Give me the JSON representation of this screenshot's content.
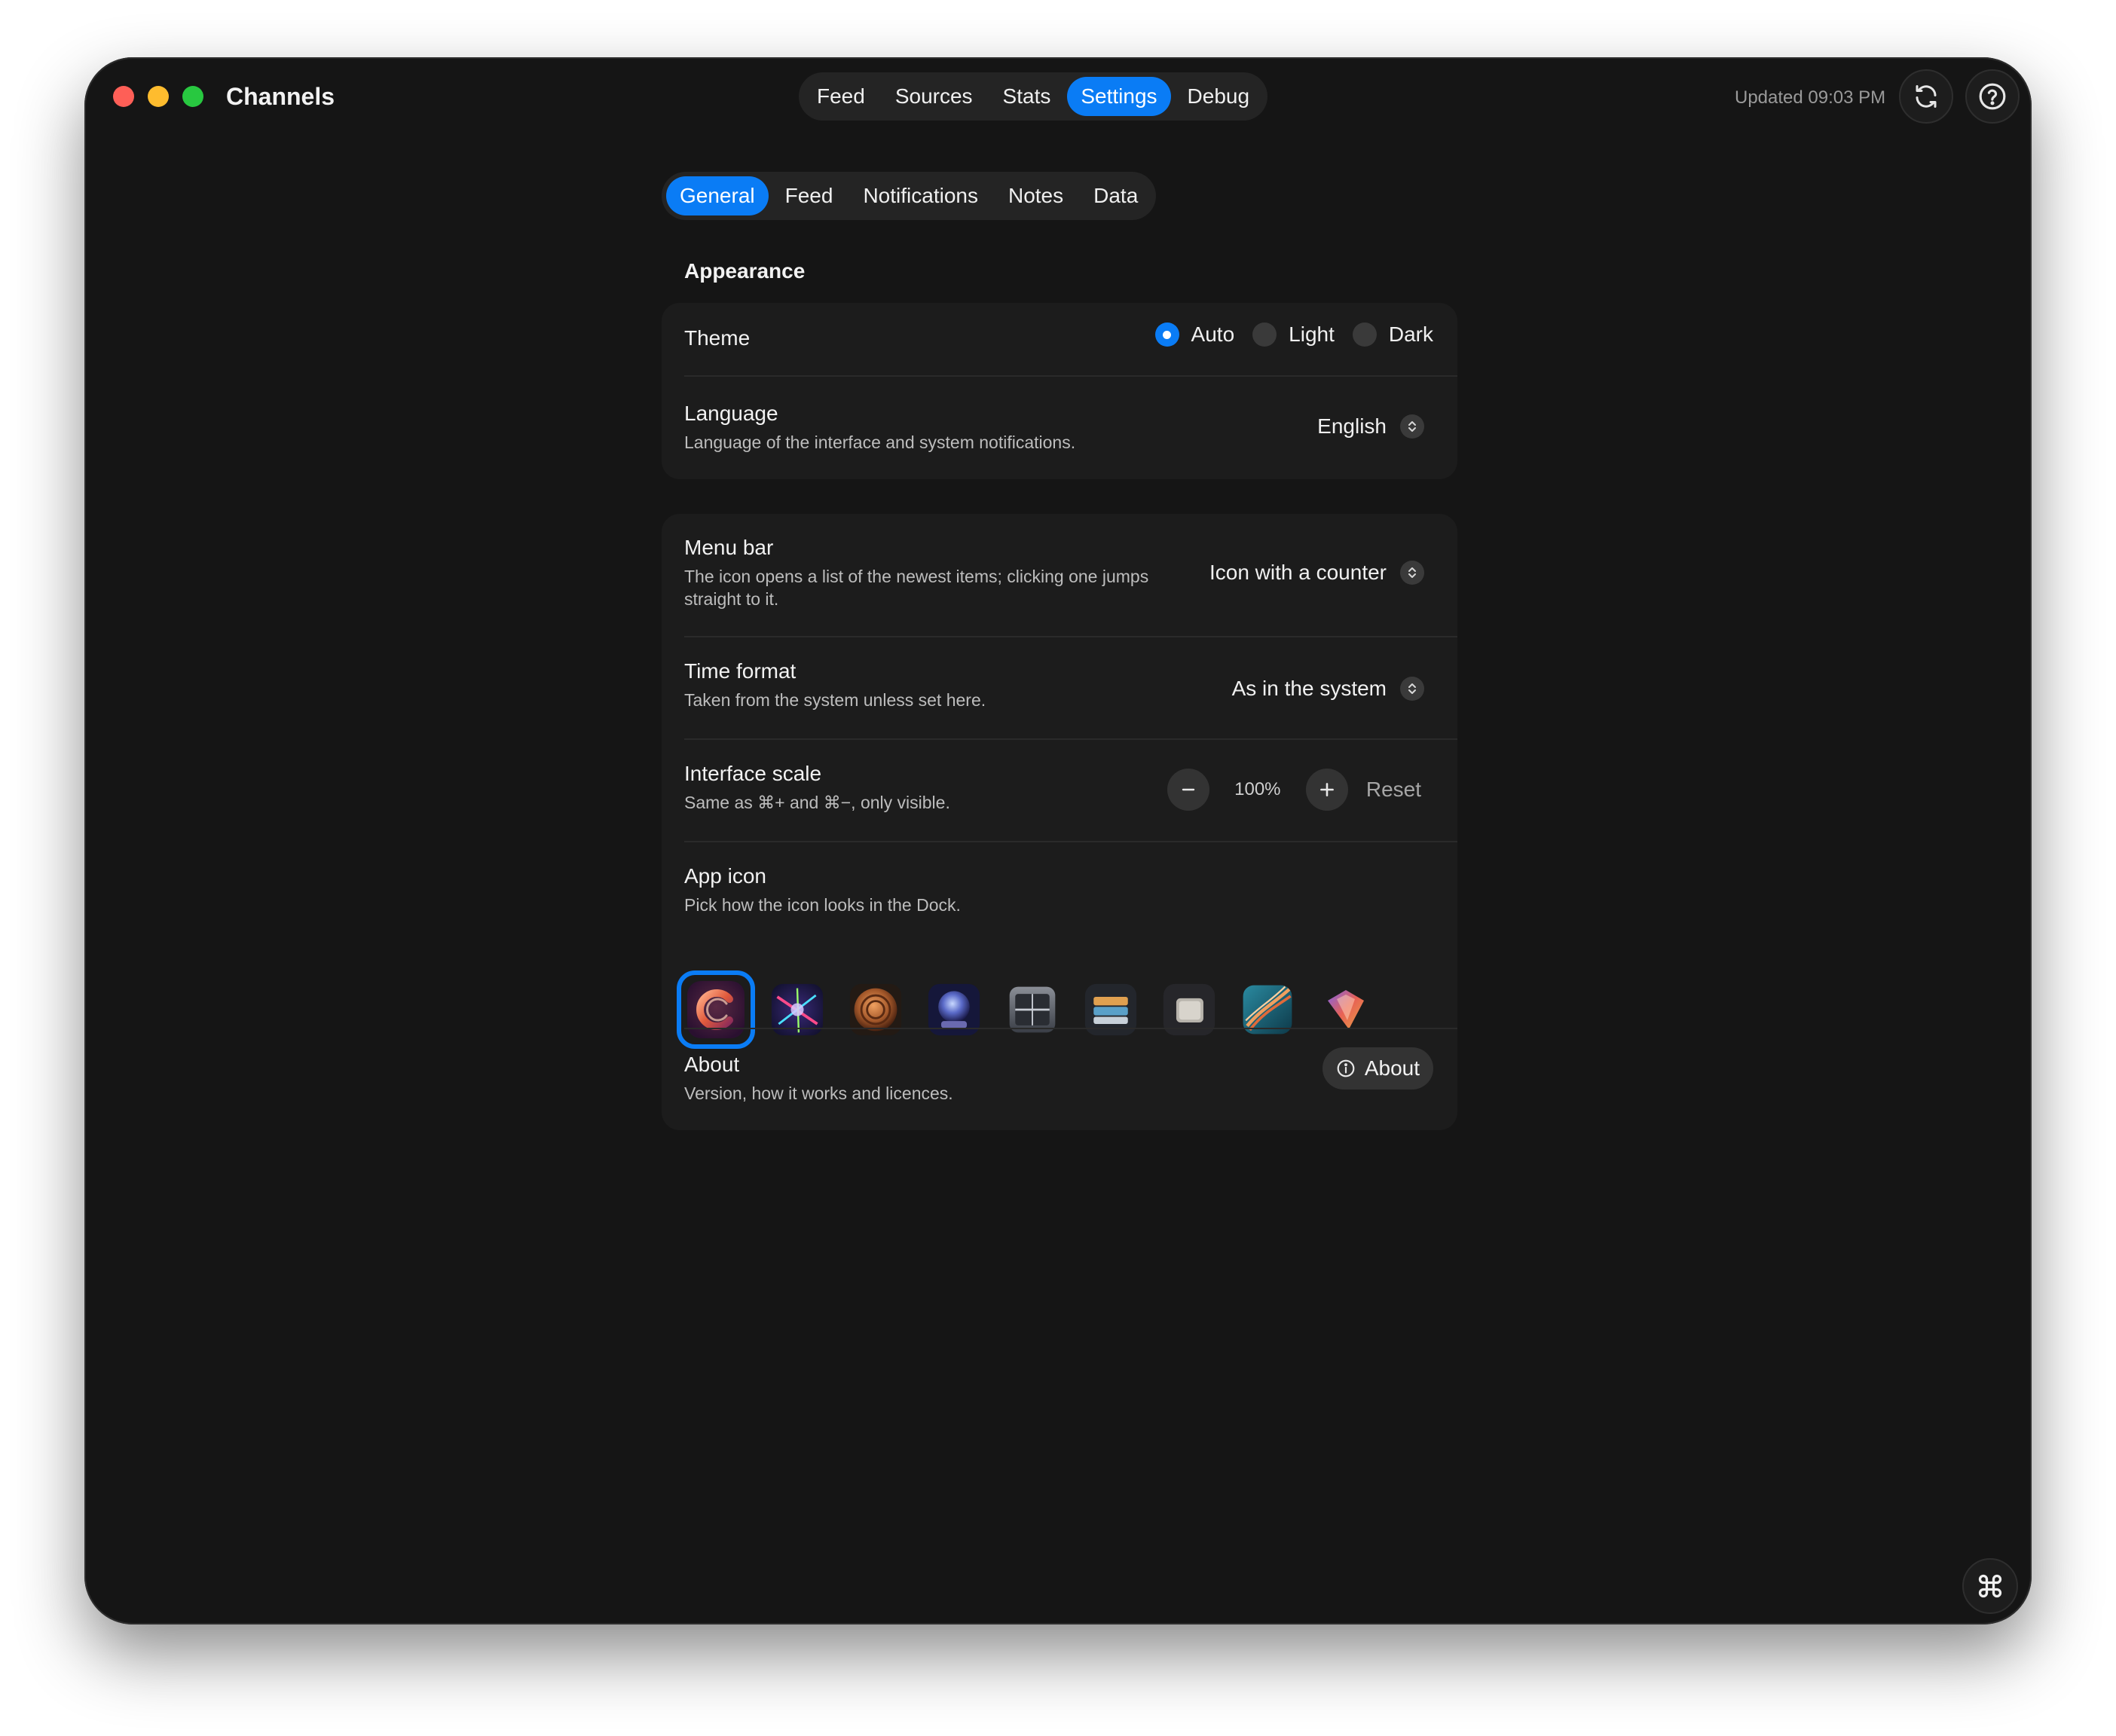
{
  "window": {
    "title": "Channels",
    "updated": "Updated 09:03 PM"
  },
  "top_tabs": [
    {
      "label": "Feed",
      "active": false
    },
    {
      "label": "Sources",
      "active": false
    },
    {
      "label": "Stats",
      "active": false
    },
    {
      "label": "Settings",
      "active": true
    },
    {
      "label": "Debug",
      "active": false
    }
  ],
  "sub_tabs": [
    {
      "label": "General",
      "active": true
    },
    {
      "label": "Feed",
      "active": false
    },
    {
      "label": "Notifications",
      "active": false
    },
    {
      "label": "Notes",
      "active": false
    },
    {
      "label": "Data",
      "active": false
    }
  ],
  "appearance": {
    "heading": "Appearance",
    "theme": {
      "title": "Theme",
      "options": [
        {
          "label": "Auto",
          "selected": true
        },
        {
          "label": "Light",
          "selected": false
        },
        {
          "label": "Dark",
          "selected": false
        }
      ]
    },
    "language": {
      "title": "Language",
      "description": "Language of the interface and system notifications.",
      "value": "English"
    }
  },
  "general": {
    "menu_bar": {
      "title": "Menu bar",
      "description": "The icon opens a list of the newest items; clicking one jumps straight to it.",
      "value": "Icon with a counter"
    },
    "time_format": {
      "title": "Time format",
      "description": "Taken from the system unless set here.",
      "value": "As in the system"
    },
    "interface_scale": {
      "title": "Interface scale",
      "description": "Same as ⌘+ and ⌘−, only visible.",
      "value": "100%",
      "reset_label": "Reset"
    },
    "app_icon": {
      "title": "App icon",
      "description": "Pick how the icon looks in the Dock.",
      "selected_index": 0,
      "icons": [
        "classic-icon",
        "prism-icon",
        "bronze-icon",
        "globe-icon",
        "steel-icon",
        "archive-icon",
        "paper-icon",
        "ribbon-icon",
        "gem-icon"
      ]
    },
    "about": {
      "title": "About",
      "description": "Version, how it works and licences.",
      "button_label": "About"
    }
  },
  "colors": {
    "accent": "#0a7cf5",
    "window_bg": "#151515",
    "card_bg": "#1c1c1c"
  }
}
